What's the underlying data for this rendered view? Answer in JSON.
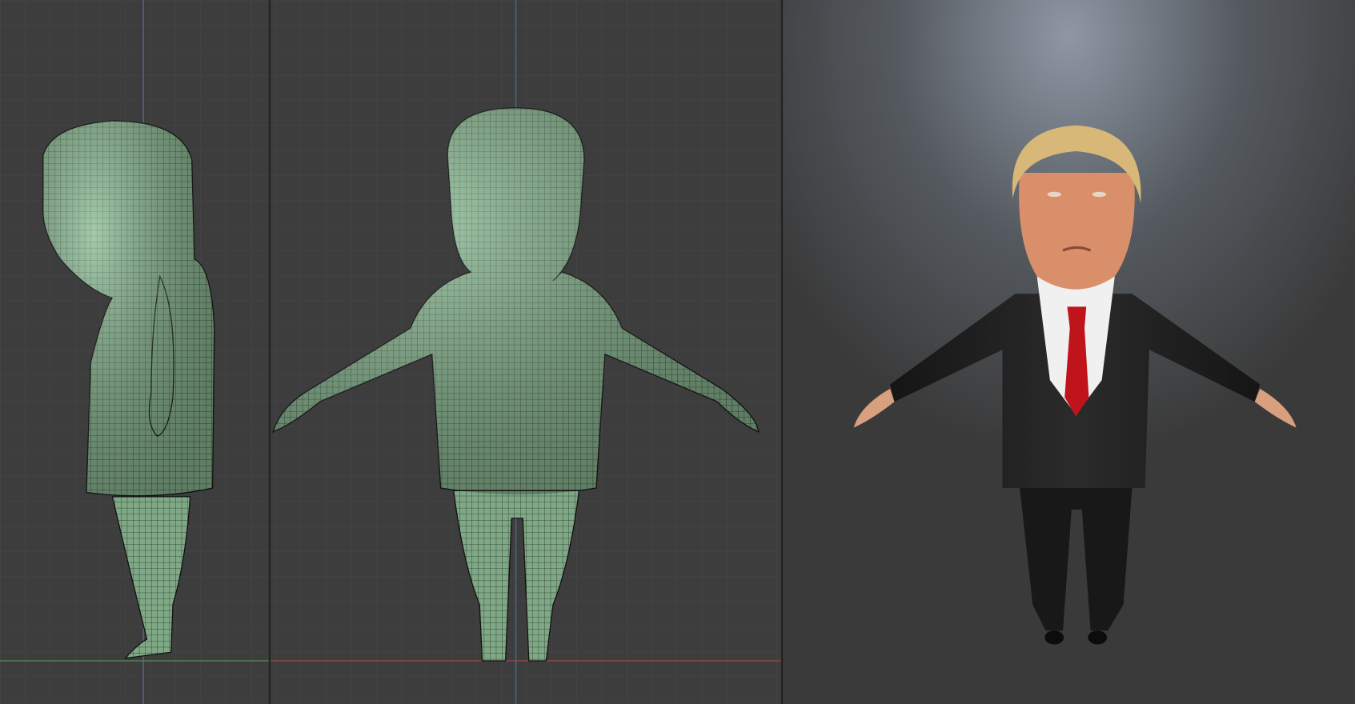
{
  "viewports": [
    {
      "id": "side-ortho",
      "view": "side",
      "shading": "solid-wireframe"
    },
    {
      "id": "front-ortho",
      "view": "front",
      "shading": "solid-wireframe"
    },
    {
      "id": "rendered",
      "view": "perspective",
      "shading": "rendered"
    }
  ],
  "colors": {
    "grid_bg": "#3d3d3d",
    "grid_line": "#474747",
    "axis_y": "#5a8a5a",
    "axis_x": "#9a4a4a",
    "axis_z": "#4a6a9a",
    "mesh": "#7fa886",
    "suit": "#1e1e1e",
    "tie": "#c0141c",
    "hair": "#d8b878",
    "skin": "#d9906a"
  }
}
